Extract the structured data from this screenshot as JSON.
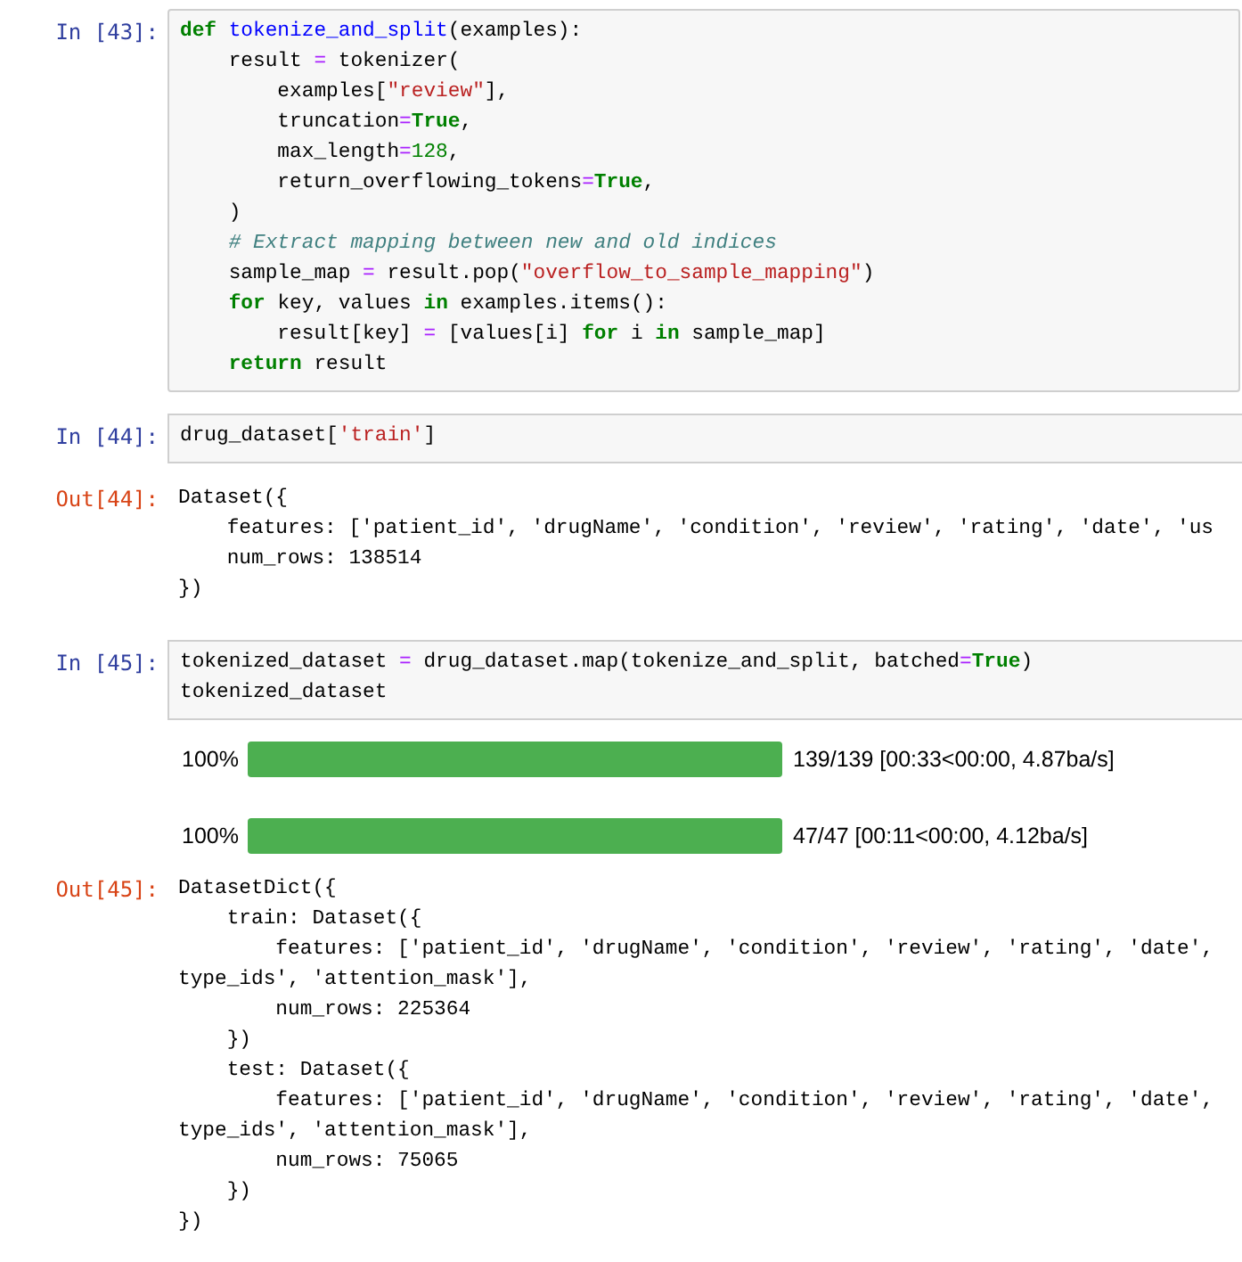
{
  "cells": [
    {
      "kind": "input",
      "prompt": "In [43]:",
      "closed_right": true,
      "lines": [
        [
          {
            "text": "def ",
            "kind": "kw"
          },
          {
            "text": "tokenize_and_split",
            "kind": "fn"
          },
          {
            "text": "(examples):",
            "kind": "plain"
          }
        ],
        [
          {
            "text": "    result ",
            "kind": "plain"
          },
          {
            "text": "=",
            "kind": "op"
          },
          {
            "text": " tokenizer(",
            "kind": "plain"
          }
        ],
        [
          {
            "text": "        examples[",
            "kind": "plain"
          },
          {
            "text": "\"review\"",
            "kind": "str"
          },
          {
            "text": "],",
            "kind": "plain"
          }
        ],
        [
          {
            "text": "        truncation",
            "kind": "plain"
          },
          {
            "text": "=",
            "kind": "op"
          },
          {
            "text": "True",
            "kind": "kw"
          },
          {
            "text": ",",
            "kind": "plain"
          }
        ],
        [
          {
            "text": "        max_length",
            "kind": "plain"
          },
          {
            "text": "=",
            "kind": "op"
          },
          {
            "text": "128",
            "kind": "num"
          },
          {
            "text": ",",
            "kind": "plain"
          }
        ],
        [
          {
            "text": "        return_overflowing_tokens",
            "kind": "plain"
          },
          {
            "text": "=",
            "kind": "op"
          },
          {
            "text": "True",
            "kind": "kw"
          },
          {
            "text": ",",
            "kind": "plain"
          }
        ],
        [
          {
            "text": "    )",
            "kind": "plain"
          }
        ],
        [
          {
            "text": "    # Extract mapping between new and old indices",
            "kind": "com"
          }
        ],
        [
          {
            "text": "    sample_map ",
            "kind": "plain"
          },
          {
            "text": "=",
            "kind": "op"
          },
          {
            "text": " result.pop(",
            "kind": "plain"
          },
          {
            "text": "\"overflow_to_sample_mapping\"",
            "kind": "str"
          },
          {
            "text": ")",
            "kind": "plain"
          }
        ],
        [
          {
            "text": "    for",
            "kind": "kw"
          },
          {
            "text": " key, values ",
            "kind": "plain"
          },
          {
            "text": "in",
            "kind": "kw"
          },
          {
            "text": " examples.items():",
            "kind": "plain"
          }
        ],
        [
          {
            "text": "        result[key] ",
            "kind": "plain"
          },
          {
            "text": "=",
            "kind": "op"
          },
          {
            "text": " [values[i] ",
            "kind": "plain"
          },
          {
            "text": "for",
            "kind": "kw"
          },
          {
            "text": " i ",
            "kind": "plain"
          },
          {
            "text": "in",
            "kind": "kw"
          },
          {
            "text": " sample_map]",
            "kind": "plain"
          }
        ],
        [
          {
            "text": "    return",
            "kind": "kw"
          },
          {
            "text": " result",
            "kind": "plain"
          }
        ]
      ]
    },
    {
      "kind": "input",
      "prompt": "In [44]:",
      "closed_right": false,
      "lines": [
        [
          {
            "text": "drug_dataset[",
            "kind": "plain"
          },
          {
            "text": "'train'",
            "kind": "str"
          },
          {
            "text": "]",
            "kind": "plain"
          }
        ]
      ]
    },
    {
      "kind": "output",
      "prompt": "Out[44]:",
      "lines": [
        "Dataset({",
        "    features: ['patient_id', 'drugName', 'condition', 'review', 'rating', 'date', 'us",
        "    num_rows: 138514",
        "})"
      ]
    },
    {
      "kind": "input",
      "prompt": "In [45]:",
      "closed_right": false,
      "lines": [
        [
          {
            "text": "tokenized_dataset ",
            "kind": "plain"
          },
          {
            "text": "=",
            "kind": "op"
          },
          {
            "text": " drug_dataset.map(tokenize_and_split, batched",
            "kind": "plain"
          },
          {
            "text": "=",
            "kind": "op"
          },
          {
            "text": "True",
            "kind": "kw"
          },
          {
            "text": ")",
            "kind": "plain"
          }
        ],
        [
          {
            "text": "tokenized_dataset",
            "kind": "plain"
          }
        ]
      ]
    },
    {
      "kind": "progress",
      "bars": [
        {
          "percent": "100%",
          "level": 1,
          "info": "139/139 [00:33<00:00, 4.87ba/s]"
        },
        {
          "percent": "100%",
          "level": 1,
          "info": "47/47 [00:11<00:00, 4.12ba/s]"
        }
      ]
    },
    {
      "kind": "output",
      "prompt": "Out[45]:",
      "lines": [
        "DatasetDict({",
        "    train: Dataset({",
        "        features: ['patient_id', 'drugName', 'condition', 'review', 'rating', 'date',",
        "type_ids', 'attention_mask'],",
        "        num_rows: 225364",
        "    })",
        "    test: Dataset({",
        "        features: ['patient_id', 'drugName', 'condition', 'review', 'rating', 'date',",
        "type_ids', 'attention_mask'],",
        "        num_rows: 75065",
        "    })",
        "})"
      ]
    }
  ]
}
